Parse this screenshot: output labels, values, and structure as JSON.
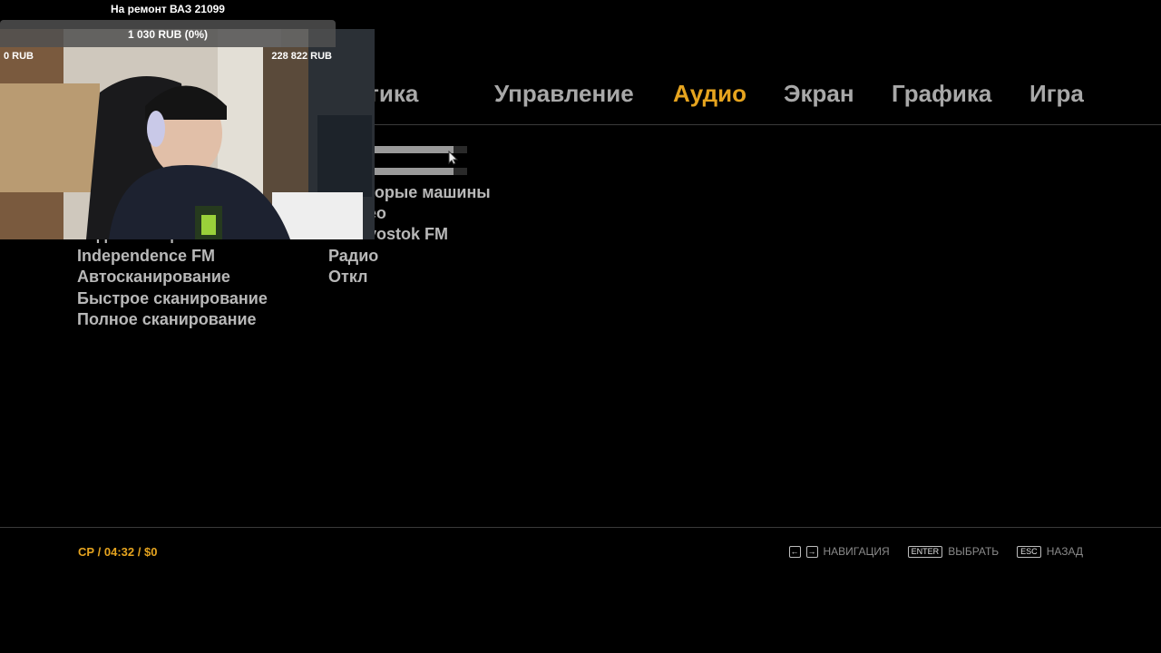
{
  "tabs": [
    {
      "label": "Статистика",
      "active": false
    },
    {
      "label": "Управление",
      "active": false
    },
    {
      "label": "Аудио",
      "active": true
    },
    {
      "label": "Экран",
      "active": false
    },
    {
      "label": "Графика",
      "active": false
    },
    {
      "label": "Игра",
      "active": false
    }
  ],
  "settings": {
    "sliders": [
      {
        "level": 0.9
      },
      {
        "level": 0.9
      }
    ],
    "rows": [
      {
        "label": "",
        "value": "Некоторые машины"
      },
      {
        "label": "",
        "value": "Стерео"
      },
      {
        "label": "Радиостанция",
        "value": "Vladivostok FM"
      },
      {
        "label": "Independence FM",
        "value": "Радио"
      },
      {
        "label": "Автосканирование",
        "value": "Откл"
      },
      {
        "label": "Быстрое сканирование",
        "value": ""
      },
      {
        "label": "Полное сканирование",
        "value": ""
      }
    ]
  },
  "status": {
    "text": "СР / 04:32 / $0"
  },
  "hints": {
    "nav_label": "НАВИГАЦИЯ",
    "enter_key": "ENTER",
    "select_label": "ВЫБРАТЬ",
    "esc_key": "ESC",
    "back_label": "НАЗАД"
  },
  "donation": {
    "title": "На ремонт ВАЗ 21099",
    "amount": "1 030 RUB (0%)",
    "min": "0 RUB",
    "max": "228 822 RUB"
  },
  "colors": {
    "accent": "#e6a41f",
    "text": "#b8b8b8",
    "background": "#000000"
  }
}
